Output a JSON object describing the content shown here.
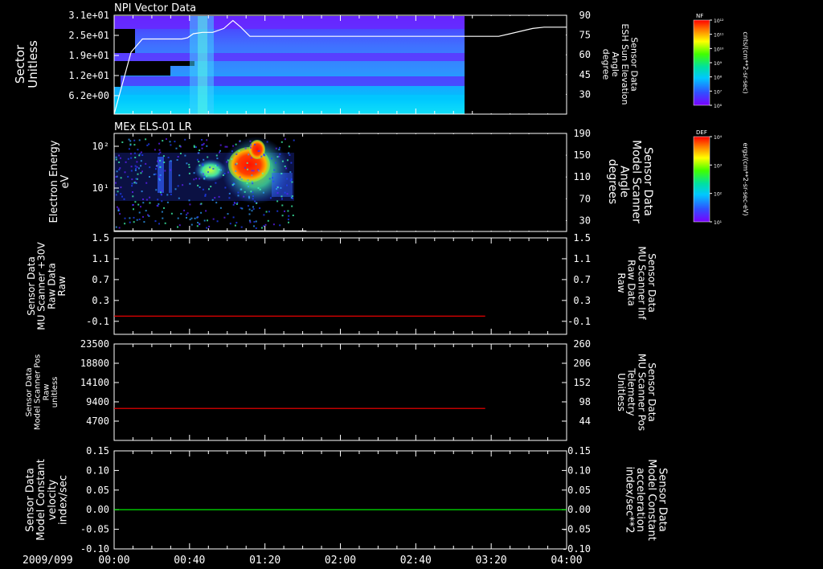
{
  "colors": {
    "white": "#ffffff",
    "red": "#ff0000",
    "green": "#00ff00",
    "background": "#000000"
  },
  "time_axis": {
    "date_label": "2009/099",
    "ticks": [
      "00:00",
      "00:40",
      "01:20",
      "02:00",
      "02:40",
      "03:20",
      "04:00"
    ]
  },
  "chart_data": [
    {
      "type": "heatmap",
      "title": "NPI Vector Data",
      "ylabel": "Sector\nUnitless",
      "y_ticks": [
        "3.1e+01",
        "2.5e+01",
        "1.9e+01",
        "1.2e+01",
        "6.2e+00"
      ],
      "right_axis": {
        "label": "Sensor Data\nESH Sun Elevation\nAngle\ndegree",
        "ticks": [
          "90",
          "75",
          "60",
          "45",
          "30"
        ],
        "ylim": [
          15,
          90
        ]
      },
      "colorbar": {
        "name": "NF",
        "units": "cnts/(cm**2-sr-sec)",
        "ticks": [
          "10¹²",
          "10¹¹",
          "10¹⁰",
          "10⁹",
          "10⁸",
          "10⁷",
          "10⁶"
        ]
      },
      "overlay_line": {
        "name": "ESH Sun Elevation Angle",
        "x_hours": [
          0,
          0.15,
          0.25,
          0.6,
          0.65,
          0.7,
          0.78,
          0.87,
          0.97,
          1.05,
          1.12,
          1.2,
          1.4,
          2.5,
          3.4,
          3.5,
          3.7,
          3.8,
          4.0
        ],
        "y": [
          15,
          62,
          72,
          72,
          73,
          76,
          77,
          77,
          80,
          86,
          81,
          74,
          74,
          74,
          74,
          76,
          80,
          81,
          81
        ]
      },
      "data_coverage_hours": [
        0,
        3.22
      ]
    },
    {
      "type": "heatmap",
      "title": "MEx ELS-01 LR",
      "ylabel": "Electron Energy\neV",
      "y_ticks": [
        "10²",
        "10¹"
      ],
      "right_axis": {
        "label": "Sensor Data\nModel Scanner\nAngle\ndegrees",
        "ticks": [
          "190",
          "150",
          "110",
          "70",
          "30"
        ],
        "ylim": [
          10,
          190
        ]
      },
      "colorbar": {
        "name": "DEF",
        "units": "ergs/(cm**2-sr-sec-eV)",
        "ticks": [
          "10⁴",
          "10³",
          "10²",
          "10¹"
        ]
      },
      "overlay_line": {
        "name": "Model Scanner Angle",
        "x_hours": [
          0,
          1.7
        ],
        "y": [
          11,
          11
        ]
      },
      "data_coverage_hours": [
        0,
        1.7
      ]
    },
    {
      "type": "line",
      "ylabel": "Sensor Data\nMU Scanner +30V\nRaw Data\nRaw",
      "y_ticks": [
        "1.5",
        "1.1",
        "0.7",
        "0.3",
        "-0.1"
      ],
      "ylim": [
        -0.35,
        1.5
      ],
      "right_axis": {
        "label": "Sensor Data\nMU Scanner Inf\nRaw Data\nRaw",
        "ticks": [
          "1.5",
          "1.1",
          "0.7",
          "0.3",
          "-0.1"
        ]
      },
      "series": [
        {
          "x_hours": [
            0,
            3.28
          ],
          "y": [
            0,
            0
          ],
          "color": "#ff0000"
        }
      ]
    },
    {
      "type": "line",
      "ylabel": "Sensor Data\nModel Scanner Pos\nRaw\nunitless",
      "y_ticks": [
        "23500",
        "18800",
        "14100",
        "9400",
        "4700"
      ],
      "ylim": [
        0,
        23500
      ],
      "right_axis": {
        "label": "Sensor Data\nMU Scanner Pos\nTelemetry\nUnitless",
        "ticks": [
          "260",
          "206",
          "152",
          "98",
          "44"
        ]
      },
      "series": [
        {
          "x_hours": [
            0,
            3.28
          ],
          "y": [
            7800,
            7800
          ],
          "color": "#ff0000"
        }
      ]
    },
    {
      "type": "line",
      "ylabel": "Sensor Data\nModel Constant\nvelocity\nindex/sec",
      "y_ticks": [
        "0.15",
        "0.10",
        "0.05",
        "0.00",
        "-0.05",
        "-0.10"
      ],
      "ylim": [
        -0.1,
        0.15
      ],
      "right_axis": {
        "label": "Sensor Data\nModel Constant\nacceleration\nindex/sec**2",
        "ticks": [
          "0.15",
          "0.10",
          "0.05",
          "0.00",
          "-0.05",
          "-0.10"
        ]
      },
      "series": [
        {
          "x_hours": [
            0,
            4.0
          ],
          "y": [
            0,
            0
          ],
          "color": "#00ff00"
        }
      ]
    }
  ]
}
